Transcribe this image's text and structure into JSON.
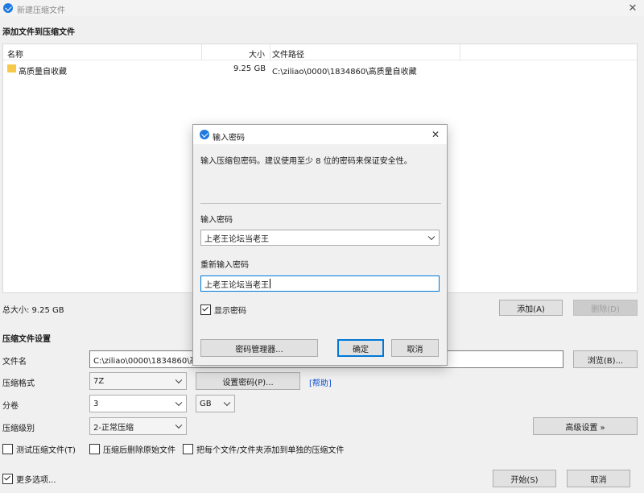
{
  "window": {
    "title": "新建压缩文件"
  },
  "files_section": {
    "heading": "添加文件到压缩文件",
    "columns": {
      "name": "名称",
      "size": "大小",
      "path": "文件路径"
    },
    "rows": [
      {
        "name": "高质量自收藏",
        "size": "9.25 GB",
        "path": "C:\\ziliao\\0000\\1834860\\高质量自收藏"
      }
    ],
    "total_size": "总大小: 9.25 GB",
    "add_label": "添加(A)",
    "delete_label": "删除(D)"
  },
  "settings": {
    "heading": "压缩文件设置",
    "filename_label": "文件名",
    "filename_value": "C:\\ziliao\\0000\\1834860\\高质",
    "browse_label": "浏览(B)...",
    "format_label": "压缩格式",
    "format_value": "7Z",
    "set_password_label": "设置密码(P)...",
    "help_label": "[帮助]",
    "split_label": "分卷",
    "split_value": "3",
    "split_unit": "GB",
    "level_label": "压缩级别",
    "level_value": "2-正常压缩",
    "advanced_label": "高级设置 »",
    "option_test": "测试压缩文件(T)",
    "option_delete_source": "压缩后删除原始文件",
    "option_each_separate": "把每个文件/文件夹添加到单独的压缩文件",
    "more_options": "更多选项...",
    "start_label": "开始(S)",
    "cancel_label": "取消"
  },
  "dialog": {
    "title": "输入密码",
    "description": "输入压缩包密码。建议使用至少 8 位的密码来保证安全性。",
    "password_label": "输入密码",
    "password_value": "上老王论坛当老王",
    "reenter_label": "重新输入密码",
    "reenter_value": "上老王论坛当老王",
    "show_password_label": "显示密码",
    "manager_label": "密码管理器...",
    "ok_label": "确定",
    "cancel_label": "取消"
  },
  "colors": {
    "accent": "#0078d7",
    "link": "#0b4fd3",
    "folder": "#f7c948"
  }
}
